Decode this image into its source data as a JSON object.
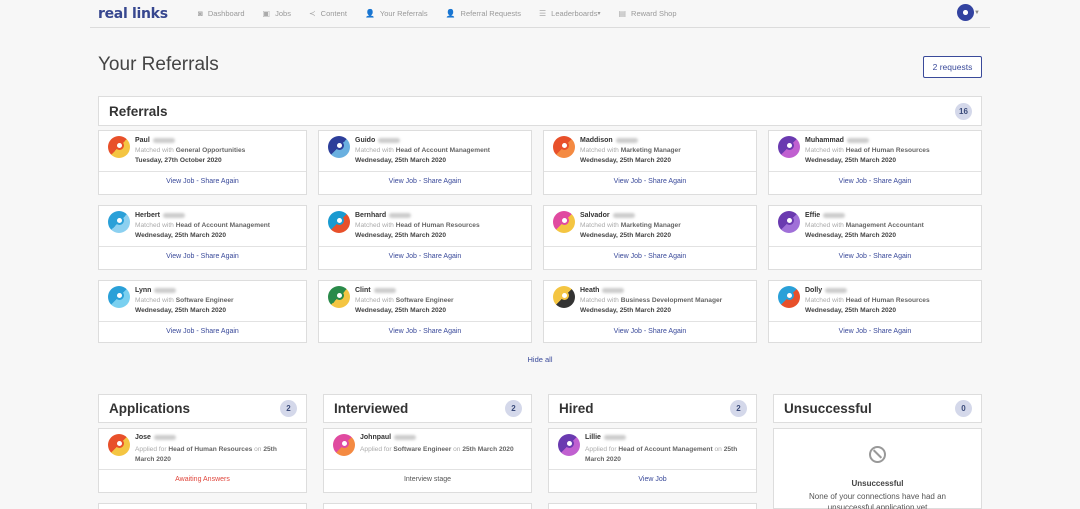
{
  "nav": {
    "logo": "real links",
    "items": [
      {
        "label": "Dashboard",
        "icon": "dashboard-icon",
        "glyph": "◙"
      },
      {
        "label": "Jobs",
        "icon": "briefcase-icon",
        "glyph": "▣"
      },
      {
        "label": "Content",
        "icon": "share-icon",
        "glyph": "≺"
      },
      {
        "label": "Your Referrals",
        "icon": "user-icon",
        "glyph": "👤"
      },
      {
        "label": "Referral Requests",
        "icon": "user-plus-icon",
        "glyph": "👤"
      },
      {
        "label": "Leaderboards",
        "icon": "list-icon",
        "glyph": "☰"
      },
      {
        "label": "Reward Shop",
        "icon": "shop-icon",
        "glyph": "▤"
      }
    ],
    "leaderboards_caret": "▾"
  },
  "page_title": "Your Referrals",
  "requests_button": "2 requests",
  "referrals": {
    "title": "Referrals",
    "count": "16",
    "cards": [
      {
        "name": "Paul",
        "role": "General Opportunities",
        "date": "Tuesday, 27th October 2020",
        "colors": [
          "#e8502a",
          "#f4c542"
        ]
      },
      {
        "name": "Guido",
        "role": "Head of Account Management",
        "date": "Wednesday, 25th March 2020",
        "colors": [
          "#2c3e9a",
          "#6ab0e0"
        ]
      },
      {
        "name": "Maddison",
        "role": "Marketing Manager",
        "date": "Wednesday, 25th March 2020",
        "colors": [
          "#e8502a",
          "#f48a42"
        ]
      },
      {
        "name": "Muhammad",
        "role": "Head of Human Resources",
        "date": "Wednesday, 25th March 2020",
        "colors": [
          "#6a3ab0",
          "#c060d0"
        ]
      },
      {
        "name": "Herbert",
        "role": "Head of Account Management",
        "date": "Wednesday, 25th March 2020",
        "colors": [
          "#2aa0d8",
          "#8cd0f0"
        ]
      },
      {
        "name": "Bernhard",
        "role": "Head of Human Resources",
        "date": "Wednesday, 25th March 2020",
        "colors": [
          "#1a9ad0",
          "#e8502a"
        ]
      },
      {
        "name": "Salvador",
        "role": "Marketing Manager",
        "date": "Wednesday, 25th March 2020",
        "colors": [
          "#e04aa0",
          "#f4c542"
        ]
      },
      {
        "name": "Effie",
        "role": "Management Accountant",
        "date": "Wednesday, 25th March 2020",
        "colors": [
          "#6a3ab0",
          "#a070d8"
        ]
      },
      {
        "name": "Lynn",
        "role": "Software Engineer",
        "date": "Wednesday, 25th March 2020",
        "colors": [
          "#2aa0d8",
          "#7ad0f0"
        ]
      },
      {
        "name": "Clint",
        "role": "Software Engineer",
        "date": "Wednesday, 25th March 2020",
        "colors": [
          "#2a8a4a",
          "#f4c542"
        ]
      },
      {
        "name": "Heath",
        "role": "Business Development Manager",
        "date": "Wednesday, 25th March 2020",
        "colors": [
          "#f4c542",
          "#333333"
        ]
      },
      {
        "name": "Dolly",
        "role": "Head of Human Resources",
        "date": "Wednesday, 25th March 2020",
        "colors": [
          "#2aa0d8",
          "#e8502a"
        ]
      }
    ],
    "matched_prefix": "Matched with",
    "view_job": "View Job",
    "separator": " - ",
    "share_again": "Share Again",
    "hide_all": "Hide all"
  },
  "stages": [
    {
      "title": "Applications",
      "count": "2",
      "card": {
        "name": "Jose",
        "prefix": "Applied for",
        "role": "Head of Human Resources",
        "on": "on",
        "date": "25th March 2020",
        "action": "Awaiting Answers",
        "colors": [
          "#e8502a",
          "#f4c542"
        ]
      }
    },
    {
      "title": "Interviewed",
      "count": "2",
      "card": {
        "name": "Johnpaul",
        "prefix": "Applied for",
        "role": "Software Engineer",
        "on": "on",
        "date": "25th March 2020",
        "action": "Interview stage",
        "colors": [
          "#e04aa0",
          "#f48a42"
        ]
      }
    },
    {
      "title": "Hired",
      "count": "2",
      "card": {
        "name": "Lillie",
        "prefix": "Applied for",
        "role": "Head of Account Management",
        "on": "on",
        "date": "25th March 2020",
        "action": "View Job",
        "colors": [
          "#6a3ab0",
          "#c060d0"
        ]
      }
    },
    {
      "title": "Unsuccessful",
      "count": "0"
    }
  ],
  "unsuccessful": {
    "heading": "Unsuccessful",
    "text": "None of your connections have had an unsuccessful application yet"
  },
  "colors": {
    "accent": "#3a4a9a",
    "badge": "#d4d8ea",
    "warning": "#e0463c"
  }
}
